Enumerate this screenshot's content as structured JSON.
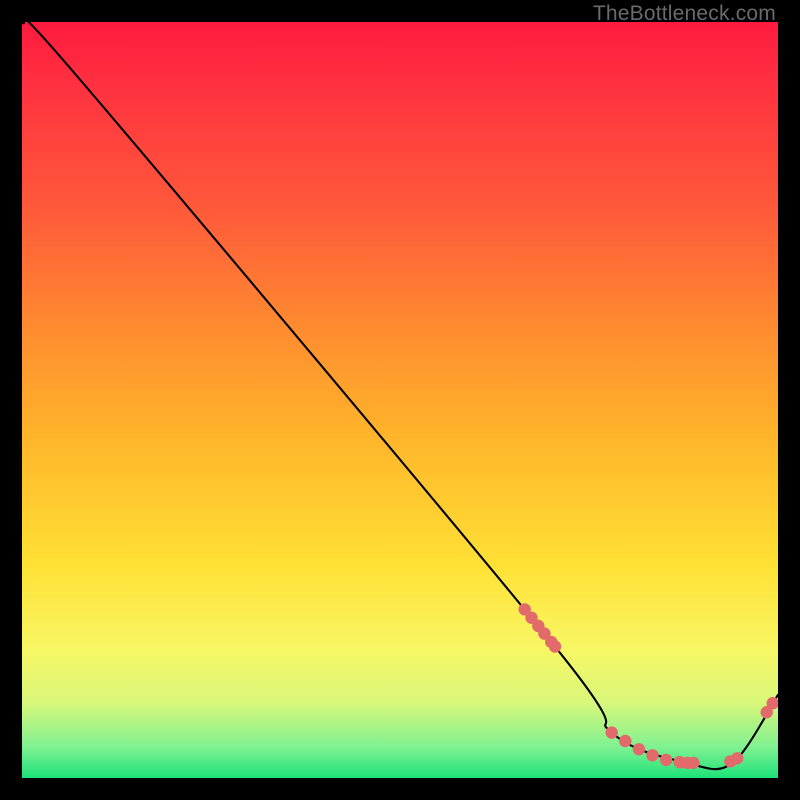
{
  "attribution": "TheBottleneck.com",
  "chart_data": {
    "type": "line",
    "title": "",
    "xlabel": "",
    "ylabel": "",
    "xlim": [
      0,
      100
    ],
    "ylim": [
      0,
      100
    ],
    "series": [
      {
        "name": "curve",
        "x": [
          0,
          8,
          70,
          78,
          88,
          94,
          100
        ],
        "y": [
          100,
          92,
          18,
          6,
          2,
          2,
          11
        ]
      }
    ],
    "markers": [
      {
        "name": "left-cluster",
        "x": [
          66.5,
          67.4,
          68.3,
          69.1,
          70.0,
          70.5
        ],
        "y": [
          22.3,
          21.2,
          20.1,
          19.1,
          18.0,
          17.4
        ]
      },
      {
        "name": "floor-cluster",
        "x": [
          78.0,
          79.8,
          81.6,
          83.4,
          85.2,
          87.0,
          88.0,
          88.8
        ],
        "y": [
          6.0,
          4.9,
          3.8,
          3.0,
          2.4,
          2.1,
          2.0,
          2.0
        ]
      },
      {
        "name": "right-pair",
        "x": [
          93.7,
          94.6
        ],
        "y": [
          2.2,
          2.6
        ]
      },
      {
        "name": "far-right",
        "x": [
          98.5,
          99.3
        ],
        "y": [
          8.7,
          9.9
        ]
      }
    ],
    "colors": {
      "curve": "#000000",
      "marker": "#e26a6a"
    }
  }
}
